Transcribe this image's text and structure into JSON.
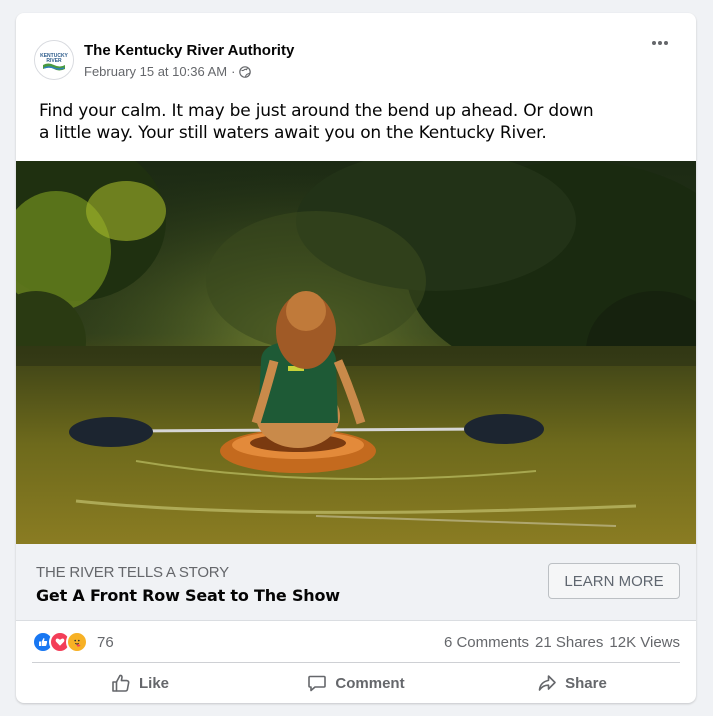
{
  "post": {
    "page_name": "The Kentucky River Authority",
    "timestamp": "February 15 at 10:36 AM",
    "separator": "·",
    "audience_icon": "globe-icon",
    "logo_text": "KENTUCKY RIVER",
    "text": "Find your calm. It may be just around the bend up ahead. Or down a little way.  Your still waters await you on the Kentucky River.",
    "more_icon": "ellipsis-icon"
  },
  "link_preview": {
    "domain": "THE RIVER TELLS A STORY",
    "headline": "Get A Front Row Seat to The Show",
    "cta_label": "LEARN MORE"
  },
  "stats": {
    "reaction_icons": [
      "like-icon",
      "love-icon",
      "care-icon"
    ],
    "reaction_count": "76",
    "comments": "6 Comments",
    "shares": "21 Shares",
    "views": "12K Views"
  },
  "actions": {
    "like": "Like",
    "comment": "Comment",
    "share": "Share"
  },
  "colors": {
    "like_blue": "#1877f2",
    "love_red": "#f33e58",
    "care_yellow": "#f7b125",
    "secondary_text": "#65676b"
  }
}
